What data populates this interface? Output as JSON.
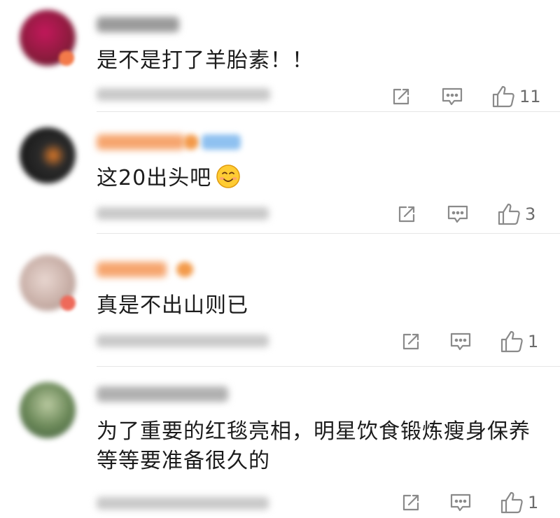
{
  "comments": [
    {
      "text": "是不是打了羊胎素！！",
      "likes": "11"
    },
    {
      "text": "这20出头吧",
      "emoji": "smiling-face",
      "likes": "3"
    },
    {
      "text": "真是不出山则已",
      "likes": "1"
    },
    {
      "text": "为了重要的红毯亮相，明星饮食锻炼瘦身保养等等要准备很久的",
      "likes": "1"
    }
  ],
  "colors": {
    "icon": "#8a8a8a",
    "separator": "#e6e6e6",
    "username_highlight": "#f6a56e",
    "blurred_meta": "#c8c8c8"
  },
  "icons": [
    "share-icon",
    "reply-icon",
    "thumbs-up-icon"
  ]
}
